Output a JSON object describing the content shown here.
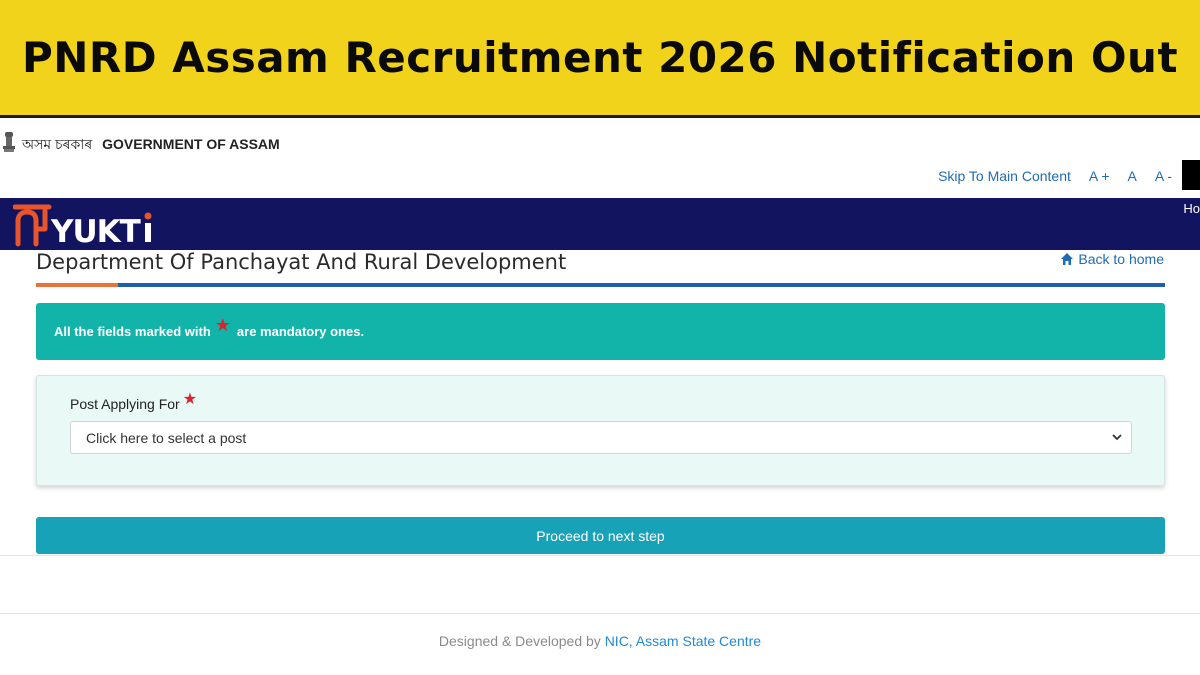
{
  "banner": {
    "title": "PNRD Assam Recruitment 2026 Notification Out"
  },
  "gov_header": {
    "assamese": "অসম চৰকাৰ",
    "english": "GOVERNMENT OF ASSAM"
  },
  "utility": {
    "skip": "Skip To Main Content",
    "font_increase": "A +",
    "font_normal": "A",
    "font_decrease": "A -"
  },
  "navbar": {
    "logo_text": "NIYUKTi",
    "menu_partial": "Ho"
  },
  "page": {
    "title": "Department Of Panchayat And Rural Development",
    "back_home": "Back to home"
  },
  "alert": {
    "prefix": "All the fields marked with",
    "star": "★",
    "suffix": "are mandatory ones."
  },
  "form": {
    "post_label": "Post Applying For",
    "required_star": "★",
    "post_select_value": "Click here to select a post"
  },
  "proceed_label": "Proceed to next step",
  "footer": {
    "prefix": "Designed & Developed by ",
    "nic": "NIC, Assam State Centre"
  },
  "colors": {
    "banner": "#f2d31b",
    "navbar": "#121460",
    "alert": "#12b3a8",
    "button": "#17a2b8",
    "accent_orange": "#e8733a",
    "link": "#1f6bb5"
  },
  "icons": {
    "emblem": "state-emblem-icon",
    "home": "home-icon",
    "chevron": "chevron-down-icon"
  }
}
